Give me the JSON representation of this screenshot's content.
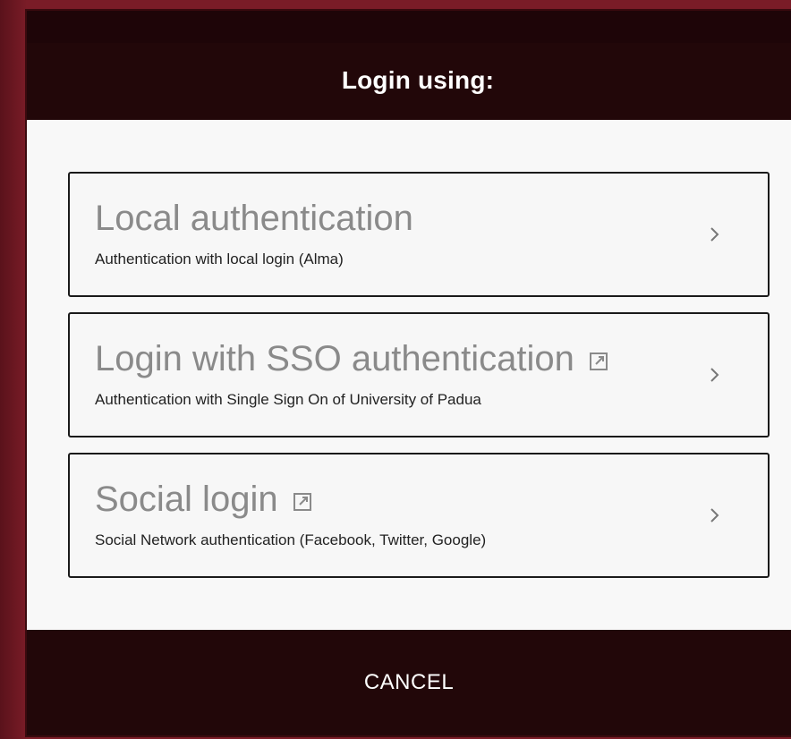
{
  "dialog": {
    "title": "Login using:",
    "cancel_label": "CANCEL"
  },
  "options": [
    {
      "title": "Local authentication",
      "subtitle": "Authentication with local login (Alma)",
      "external": false,
      "icon": "chevron-right-icon"
    },
    {
      "title": "Login with SSO authentication",
      "subtitle": "Authentication with Single Sign On of University of Padua",
      "external": true,
      "icon": "external-link-icon"
    },
    {
      "title": "Social login",
      "subtitle": "Social Network authentication (Facebook, Twitter, Google)",
      "external": true,
      "icon": "external-link-icon"
    }
  ],
  "colors": {
    "header_bg": "#220709",
    "backdrop": "#7a1c27",
    "option_title": "#8a8a8a",
    "panel_bg": "#f8f8f8"
  }
}
